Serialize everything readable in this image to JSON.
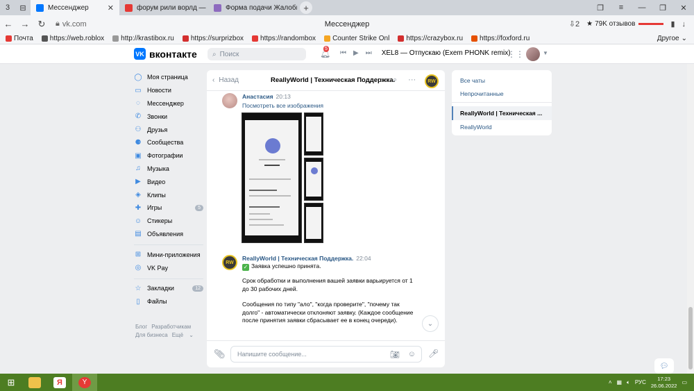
{
  "browser": {
    "tabs": [
      {
        "label": "Мессенджер",
        "active": true
      },
      {
        "label": "форум рили ворлд — Янд",
        "active": false
      },
      {
        "label": "Форма подачи Жалобы на",
        "active": false
      }
    ],
    "url": "vk.com",
    "window_title": "Мессенджер",
    "reviews": "79K отзывов",
    "sys_count": "3",
    "dl_count": "2"
  },
  "bookmarks": [
    {
      "label": "Почта",
      "color": "#e53935"
    },
    {
      "label": "https://web.roblox",
      "color": "#555555"
    },
    {
      "label": "http://krastibox.ru",
      "color": "#999999"
    },
    {
      "label": "https://surprizbox",
      "color": "#d32f2f"
    },
    {
      "label": "https://randombox",
      "color": "#e53935"
    },
    {
      "label": "Counter Strike Onl",
      "color": "#f5a623"
    },
    {
      "label": "https://crazybox.ru",
      "color": "#d32f2f"
    },
    {
      "label": "https://foxford.ru",
      "color": "#e65100"
    }
  ],
  "bookmarks_more": "Другое",
  "vk": {
    "logo_text": "вконтакте",
    "search_placeholder": "Поиск",
    "notif_count": "5",
    "track": "XEL8 — Отпускаю (Exem PHONK remix)"
  },
  "menu": [
    {
      "label": "Моя страница",
      "icon": "user-icon",
      "glyph": "◯"
    },
    {
      "label": "Новости",
      "icon": "news-icon",
      "glyph": "▭"
    },
    {
      "label": "Мессенджер",
      "icon": "chat-icon",
      "glyph": "◌"
    },
    {
      "label": "Звонки",
      "icon": "phone-icon",
      "glyph": "✆"
    },
    {
      "label": "Друзья",
      "icon": "friends-icon",
      "glyph": "⚇"
    },
    {
      "label": "Сообщества",
      "icon": "groups-icon",
      "glyph": "⚈"
    },
    {
      "label": "Фотографии",
      "icon": "photo-icon",
      "glyph": "▣"
    },
    {
      "label": "Музыка",
      "icon": "music-icon",
      "glyph": "♫"
    },
    {
      "label": "Видео",
      "icon": "video-icon",
      "glyph": "▶"
    },
    {
      "label": "Клипы",
      "icon": "clips-icon",
      "glyph": "◈"
    },
    {
      "label": "Игры",
      "icon": "games-icon",
      "glyph": "✚",
      "count": "5"
    },
    {
      "label": "Стикеры",
      "icon": "sticker-icon",
      "glyph": "☺"
    },
    {
      "label": "Объявления",
      "icon": "ads-icon",
      "glyph": "▤"
    }
  ],
  "menu2": [
    {
      "label": "Мини-приложения",
      "icon": "apps-icon",
      "glyph": "⊞"
    },
    {
      "label": "VK Pay",
      "icon": "vkpay-icon",
      "glyph": "◎"
    }
  ],
  "menu3": [
    {
      "label": "Закладки",
      "icon": "bookmark-icon",
      "glyph": "☆",
      "count": "12"
    },
    {
      "label": "Файлы",
      "icon": "files-icon",
      "glyph": "▯"
    }
  ],
  "footer": {
    "blog": "Блог",
    "dev": "Разработчикам",
    "business": "Для бизнеса",
    "more": "Ещё"
  },
  "chat": {
    "back": "Назад",
    "title": "ReallyWorld | Техническая Поддержка.",
    "msg1": {
      "author": "Анастасия",
      "time": "20:13",
      "link": "Посмотреть все изображения"
    },
    "msg2": {
      "author": "ReallyWorld | Техническая Поддержка.",
      "time": "22:04",
      "line1": "Заявка успешно принята.",
      "para2": "Срок обработки и выполнения вашей заявки варьируется от 1 до 30 рабочих дней.",
      "para3": "Сообщения по типу \"ало\", \"когда проверите\", \"почему так долго\" - автоматически отклоняют заявку. (Каждое сообщение после принятия заявки сбрасывает ее в конец очереди)."
    },
    "composer_placeholder": "Напишите сообщение..."
  },
  "right_panel": {
    "all": "Все чаты",
    "unread": "Непрочитанные",
    "selected": "ReallyWorld | Техническая ...",
    "other": "ReallyWorld"
  },
  "taskbar": {
    "lang": "РУС",
    "time": "17:23",
    "date": "26.06.2022"
  },
  "colors": {
    "vk_blue": "#0077ff",
    "link": "#2a5885",
    "taskbar": "#4d7d22"
  }
}
